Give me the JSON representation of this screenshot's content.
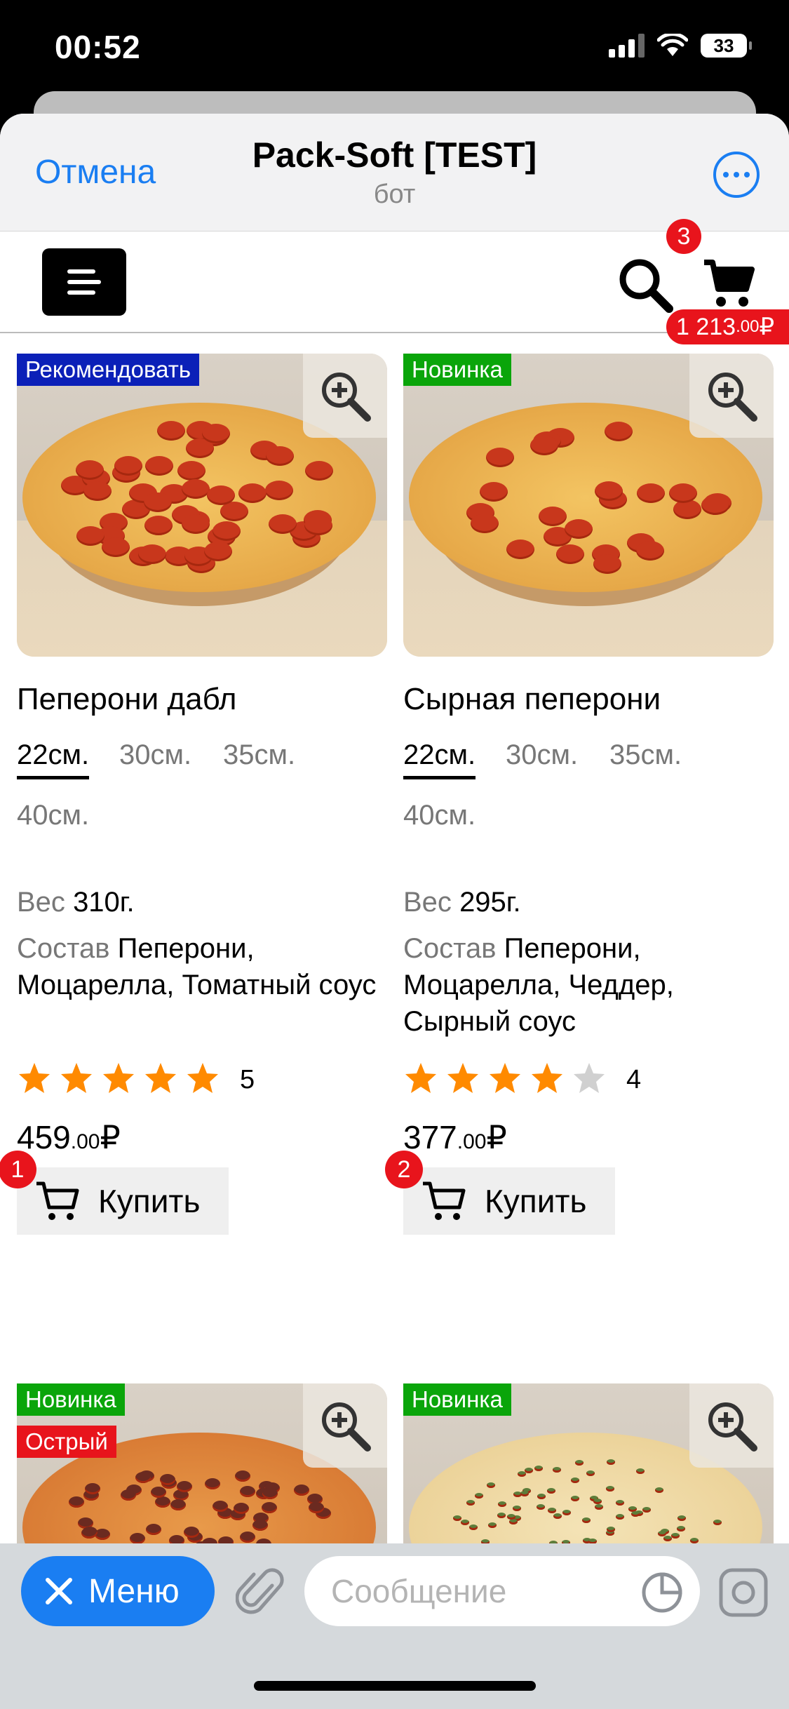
{
  "status_bar": {
    "time": "00:52",
    "battery": "33"
  },
  "telegram_header": {
    "cancel_label": "Отмена",
    "title": "Pack-Soft [TEST]",
    "subtitle": "бот"
  },
  "toolbar": {
    "cart_count": "3",
    "cart_total": {
      "main": "1 213",
      "fraction": ".00",
      "currency": "₽"
    }
  },
  "products": [
    {
      "badges": [
        {
          "text": "Рекомендовать",
          "color": "#0b20b8"
        }
      ],
      "name": "Пеперони дабл",
      "sizes": [
        "22см.",
        "30см.",
        "35см.",
        "40см."
      ],
      "selected_size": "22см.",
      "weight_label": "Вес",
      "weight": "310г.",
      "composition_label": "Состав",
      "composition": "Пеперони, Моцарелла, Томатный соус",
      "rating": 5,
      "rating_text": "5",
      "price": {
        "main": "459",
        "fraction": ".00",
        "currency": "₽"
      },
      "buy_label": "Купить",
      "in_cart_qty": "1"
    },
    {
      "badges": [
        {
          "text": "Новинка",
          "color": "#0aa50a"
        }
      ],
      "name": "Сырная пеперони",
      "sizes": [
        "22см.",
        "30см.",
        "35см.",
        "40см."
      ],
      "selected_size": "22см.",
      "weight_label": "Вес",
      "weight": "295г.",
      "composition_label": "Состав",
      "composition": "Пеперони, Моцарелла, Чеддер, Сырный соус",
      "rating": 4,
      "rating_text": "4",
      "price": {
        "main": "377",
        "fraction": ".00",
        "currency": "₽"
      },
      "buy_label": "Купить",
      "in_cart_qty": "2"
    },
    {
      "badges": [
        {
          "text": "Новинка",
          "color": "#0aa50a"
        },
        {
          "text": "Острый",
          "color": "#e8141c"
        }
      ]
    },
    {
      "badges": [
        {
          "text": "Новинка",
          "color": "#0aa50a"
        }
      ]
    }
  ],
  "bottom_bar": {
    "menu_label": "Меню",
    "message_placeholder": "Сообщение"
  },
  "colors": {
    "accent": "#1a7ef2",
    "badge_red": "#e8141c",
    "star_on": "#ff8a00",
    "star_off": "#d0d0d0"
  }
}
